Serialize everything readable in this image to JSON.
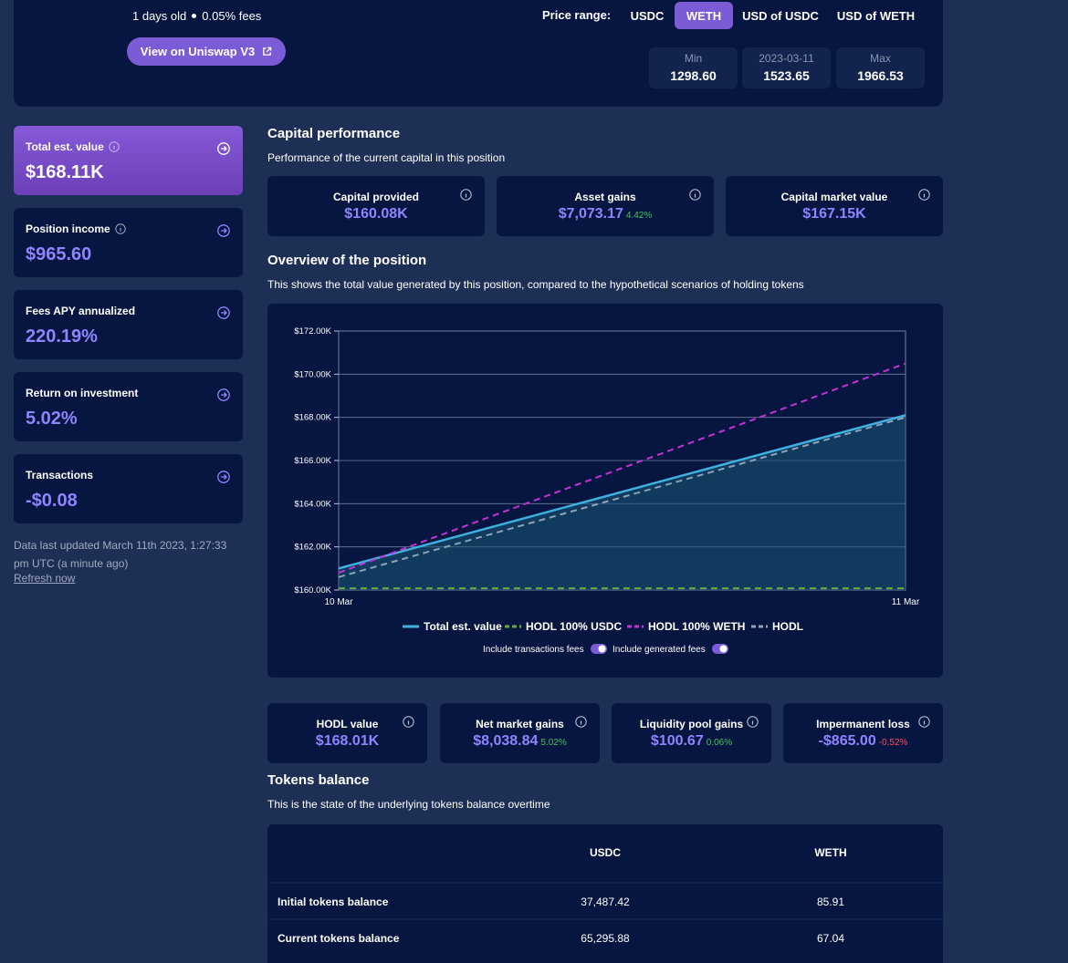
{
  "header": {
    "age": "1 days old",
    "fees": "0.05% fees",
    "uniswap_button": "View on Uniswap V3",
    "price_range_label": "Price range:",
    "range_tabs": [
      {
        "label": "USDC",
        "active": false
      },
      {
        "label": "WETH",
        "active": true
      },
      {
        "label": "USD of USDC",
        "active": false
      },
      {
        "label": "USD of WETH",
        "active": false
      }
    ],
    "range_values": [
      {
        "label": "Min",
        "value": "1298.60"
      },
      {
        "label": "2023-03-11",
        "value": "1523.65"
      },
      {
        "label": "Max",
        "value": "1966.53"
      }
    ]
  },
  "stats": [
    {
      "label": "Total est. value",
      "value": "$168.11K",
      "has_info": true
    },
    {
      "label": "Position income",
      "value": "$965.60",
      "has_info": true
    },
    {
      "label": "Fees APY annualized",
      "value": "220.19%",
      "has_info": false
    },
    {
      "label": "Return on investment",
      "value": "5.02%",
      "has_info": false
    },
    {
      "label": "Transactions",
      "value": "-$0.08",
      "has_info": false
    }
  ],
  "update_note": "Data last updated March 11th 2023, 1:27:33 pm UTC (a minute ago)",
  "refresh_label": "Refresh now",
  "capital": {
    "title": "Capital performance",
    "subtitle": "Performance of the current capital in this position",
    "cards": [
      {
        "label": "Capital provided",
        "value": "$160.08K",
        "pct": ""
      },
      {
        "label": "Asset gains",
        "value": "$7,073.17",
        "pct": "4.42%"
      },
      {
        "label": "Capital market value",
        "value": "$167.15K",
        "pct": ""
      }
    ]
  },
  "overview": {
    "title": "Overview of the position",
    "subtitle": "This shows the total value generated by this position, compared to the hypothetical scenarios of holding tokens",
    "toggle1": "Include transactions fees",
    "toggle2": "Include generated fees"
  },
  "colors": {
    "total": "#3fb0e0",
    "usdc": "#6da83c",
    "weth": "#c531d6",
    "hodl": "#8fa3b8",
    "accent": "#7b5cd6"
  },
  "chart_data": {
    "type": "line",
    "x": [
      "10 Mar",
      "11 Mar"
    ],
    "ylim": [
      160000,
      172000
    ],
    "yticks": [
      "$160.00K",
      "$162.00K",
      "$164.00K",
      "$166.00K",
      "$168.00K",
      "$170.00K",
      "$172.00K"
    ],
    "series": [
      {
        "name": "Total est. value",
        "values": [
          161000,
          168100
        ],
        "style": "solid",
        "filled": true
      },
      {
        "name": "HODL 100% USDC",
        "values": [
          160080,
          160080
        ],
        "style": "dashed"
      },
      {
        "name": "HODL 100% WETH",
        "values": [
          160800,
          170500
        ],
        "style": "dashed"
      },
      {
        "name": "HODL",
        "values": [
          160600,
          168000
        ],
        "style": "dashed"
      }
    ],
    "legend": "bottom"
  },
  "bottom_cards": [
    {
      "label": "HODL value",
      "value": "$168.01K",
      "pct": "",
      "pct_class": ""
    },
    {
      "label": "Net market gains",
      "value": "$8,038.84",
      "pct": "5.02%",
      "pct_class": "pos"
    },
    {
      "label": "Liquidity pool gains",
      "value": "$100.67",
      "pct": "0.06%",
      "pct_class": "pos"
    },
    {
      "label": "Impermanent loss",
      "value": "-$865.00",
      "pct": "-0.52%",
      "pct_class": "neg"
    }
  ],
  "tokens": {
    "title": "Tokens balance",
    "subtitle": "This is the state of the underlying tokens balance overtime",
    "columns": [
      "USDC",
      "WETH"
    ],
    "rows": [
      {
        "label": "Initial tokens balance",
        "usdc": "37,487.42",
        "weth": "85.91"
      },
      {
        "label": "Current tokens balance",
        "usdc": "65,295.88",
        "weth": "67.04"
      }
    ]
  }
}
